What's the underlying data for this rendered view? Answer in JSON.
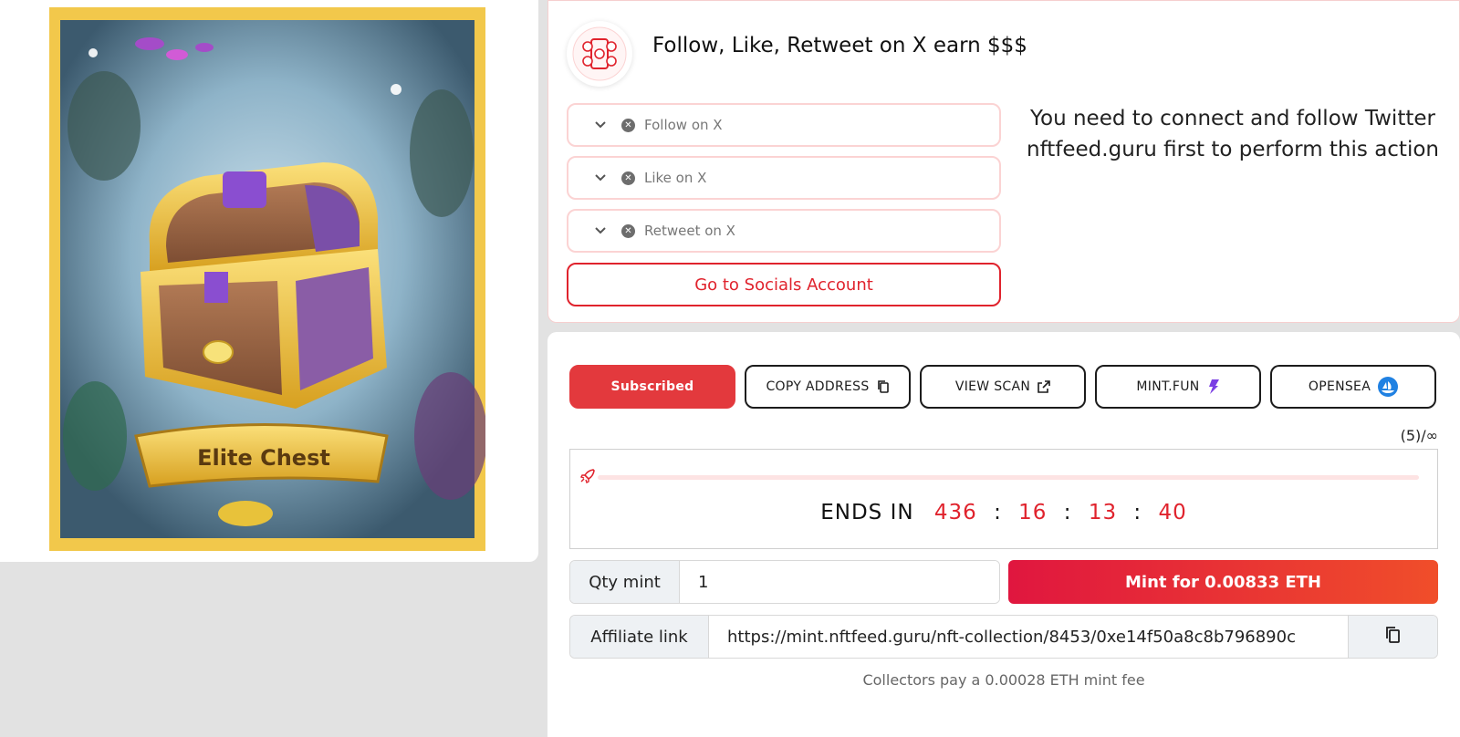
{
  "nft": {
    "name": "Elite Chest",
    "image_alt": "Elite Chest"
  },
  "social": {
    "title": "Follow, Like, Retweet on X earn $$$",
    "tasks": [
      {
        "label": "Follow on X"
      },
      {
        "label": "Like on X"
      },
      {
        "label": "Retweet on X"
      }
    ],
    "go_button": "Go to Socials Account",
    "message": "You need to connect and follow Twitter nftfeed.guru first to perform this action"
  },
  "actions": {
    "subscribed": "Subscribed",
    "copy_address": "COPY ADDRESS",
    "view_scan": "VIEW SCAN",
    "mint_fun": "MINT.FUN",
    "opensea": "OPENSEA"
  },
  "supply": {
    "count": "(5)/∞",
    "progress": 0
  },
  "countdown": {
    "label": "ENDS IN",
    "days": "436",
    "hours": "16",
    "minutes": "13",
    "seconds": "40",
    "separator": ":"
  },
  "mint": {
    "qty_label": "Qty mint",
    "qty_value": "1",
    "button": "Mint for 0.00833 ETH"
  },
  "affiliate": {
    "label": "Affiliate link",
    "value": "https://mint.nftfeed.guru/nft-collection/8453/0xe14f50a8c8b796890c"
  },
  "fee_note": "Collectors pay a 0.00028 ETH mint fee",
  "colors": {
    "accent": "#e3393d",
    "danger_text": "#e0232d"
  }
}
